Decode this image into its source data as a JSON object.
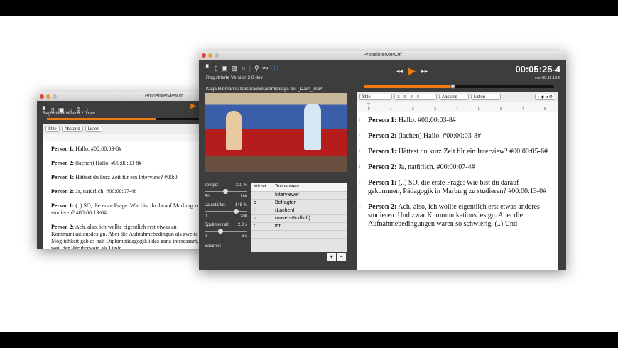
{
  "back_window": {
    "title": "Probeinterview.rtf",
    "version": "Registrierte Version 2.0 dev",
    "styles": "Stile",
    "spacing": "Abstand",
    "lists": "Listen",
    "paragraphs": [
      {
        "speaker": "Person 1:",
        "text": " Hallo. #00:00:03-8#"
      },
      {
        "speaker": "Person 2:",
        "text": " (lachen) Hallo. #00:00:03-8#"
      },
      {
        "speaker": "Person 1:",
        "text": " Hättest du kurz Zeit für ein Interview? #00:0"
      },
      {
        "speaker": "Person 2:",
        "text": " Ja, natürlich. #00:00:07-4#"
      },
      {
        "speaker": "Person 1:",
        "text": " (..) SO, die erste Frage: Wie bist du darauf Marburg zu studieren? #00:00:13-0#"
      },
      {
        "speaker": "Person 2:",
        "text": " Ach, also, ich wollte eigentlich erst etwas an Kommunikationsdesign. Aber die Aufnahmebedingun als zweite Möglichkeit gab es halt Diplompädagogik i das ganz interessant, weil der Berufszweig als Diplo"
      }
    ]
  },
  "window": {
    "title": "Probeinterview.rtf",
    "version": "Registrierte Version 2.0 dev",
    "media_title": "Katja Riemanns Gesprächskarambolage bei _Das!_.mp4",
    "time": "00:05:25-4",
    "duration": "von 00:11:13-6",
    "progress": 0.47,
    "controls": {
      "tempo_label": "Tempo:",
      "tempo_value": "110 %",
      "tempo_min": "50",
      "tempo_max": "180",
      "tempo": 110,
      "volume_label": "Lautstärke:",
      "volume_value": "148 %",
      "volume_min": "0",
      "volume_max": "200",
      "volume": 148,
      "skip_label": "Spulintervall:",
      "skip_value": "2.0 s",
      "skip_min": "0",
      "skip_max": "6 s",
      "skip": 2.0,
      "balance_label": "Balance:"
    },
    "table": {
      "headers": [
        "Kürzel",
        "Textbaustein"
      ],
      "rows": [
        [
          "i",
          "Interviewer:"
        ],
        [
          "b",
          "Befragter:"
        ],
        [
          "l",
          "(Lachen)"
        ],
        [
          "u",
          "(unverständlich)"
        ],
        [
          "t",
          "tttt"
        ]
      ],
      "add": "+",
      "remove": "−"
    },
    "editor": {
      "styles": "Stile",
      "spacing": "Abstand",
      "lists": "Listen",
      "ruler": [
        "0",
        "1",
        "2",
        "3",
        "4",
        "5",
        "6",
        "7",
        "8"
      ],
      "paragraphs": [
        {
          "n": "1",
          "speaker": "Person 1:",
          "text": " Hallo. #00:00:03-8#"
        },
        {
          "n": "2",
          "speaker": "Person 2:",
          "text": " (lachen) Hallo. #00:00:03-8#"
        },
        {
          "n": "3",
          "speaker": "Person 1:",
          "text": " Hättest du kurz Zeit für ein Interview? #00:00:05-6#"
        },
        {
          "n": "4",
          "speaker": "Person 2:",
          "text": " Ja, natürlich. #00:00:07-4#"
        },
        {
          "n": "5",
          "speaker": "Person 1:",
          "text": " (..) SO, die erste Frage: Wie bist du darauf gekommen, Pädagogik in Marburg zu studieren? #00:00:13-0#"
        },
        {
          "n": "6",
          "speaker": "Person 2:",
          "text": " Ach, also, ich wollte eigentlich erst etwas anderes studieren. Und zwar Kommunikationsdesign. Aber die Aufnahmebedingungen waren so schwierig. (..) Und"
        }
      ]
    }
  }
}
